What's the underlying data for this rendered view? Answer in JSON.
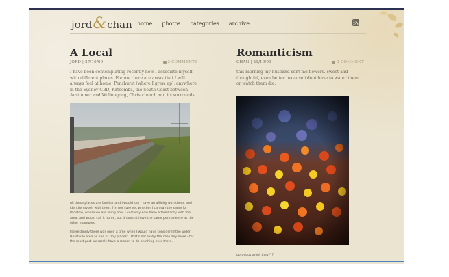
{
  "site": {
    "logo_left": "jord",
    "logo_amp": "&",
    "logo_right": "chan"
  },
  "nav": {
    "items": [
      "home",
      "photos",
      "categories",
      "archive"
    ]
  },
  "rss_label": "rss",
  "posts": [
    {
      "title": "A Local",
      "author": "JORD",
      "date": "27/10/09",
      "comments": "2 COMMENTS",
      "excerpt": "I have been contemplating recently how I associate myself with different places. For me there are areas that I will always feel at home. Penshurst (where I grew up), anywhere in the Sydney CBD, Katoomba, the South Coast between Austinmer and Wollongong, Christchurch and its surrounds.",
      "body": [
        "All these places are familiar and I would say I have an affinity with them, and identify myself with them. I'm not sure yet whether I can say the same for Padstow, where we are living now. I certainly now have a familiarity with the area, and would call it home, but it doesn't have the same permanence as the other examples.",
        "Interestingly there was once a time when I would have considered the wider Hurstville area as one of \"my places\". That's not really the case any more - for the most part we rarely have a reason to do anything over there."
      ]
    },
    {
      "title": "Romanticism",
      "author": "CHAN",
      "date": "29/10/09",
      "comments": "1 COMMENT",
      "excerpt": "this morning my husband sent me flowers. sweet and thoughtful, even better because i dont have to water them or watch them die.",
      "caption": "gorgeous arent they???"
    }
  ],
  "colors": {
    "background": "#ebe4d0",
    "top_bar": "#2d3151",
    "bottom_bar": "#4a82c2",
    "text": "#6f6b5c"
  }
}
